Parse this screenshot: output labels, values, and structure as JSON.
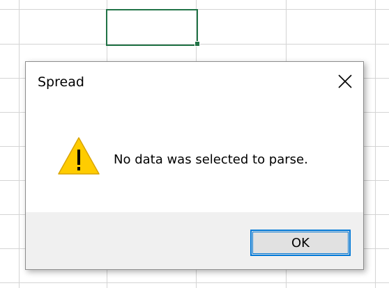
{
  "dialog": {
    "title": "Spread",
    "message": "No data was selected to parse.",
    "ok_label": "OK",
    "icon": "warning-triangle-icon",
    "close_icon": "close-icon"
  },
  "colors": {
    "selection_border": "#217346",
    "gridline": "#d4d4d4",
    "button_focus": "#0078d7",
    "footer_bg": "#f0f0f0",
    "warning_fill": "#ffcc00"
  }
}
